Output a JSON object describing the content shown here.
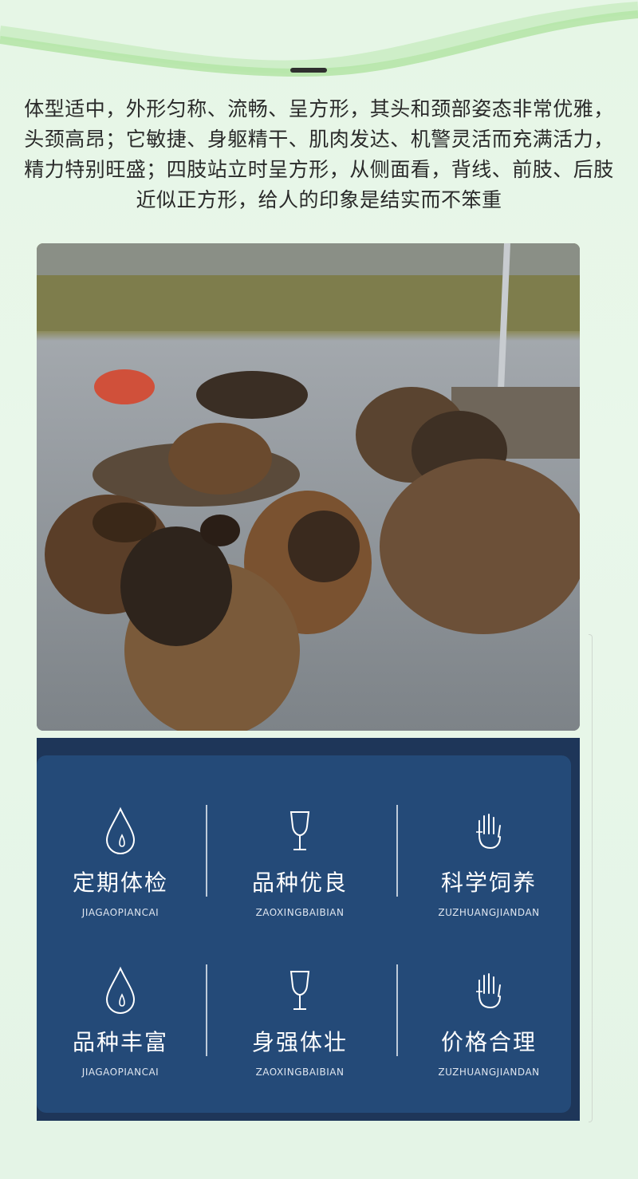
{
  "description": "体型适中，外形匀称、流畅、呈方形，其头和颈部姿态非常优雅，头颈高昂；它敏捷、身躯精干、肌肉发达、机警灵活而充满活力，精力特别旺盛；四肢站立时呈方形，从侧面看，背线、前肢、后肢近似正方形，给人的印象是结实而不笨重",
  "colors": {
    "panel_dark": "#1e3659",
    "panel_blue": "#244a78",
    "accent_green": "#b6e6a8"
  },
  "features": [
    {
      "title": "定期体检",
      "sub": "JIAGAOPIANCAI",
      "icon": "water-drop-icon"
    },
    {
      "title": "品种优良",
      "sub": "ZAOXINGBAIBIAN",
      "icon": "wine-glass-icon"
    },
    {
      "title": "科学饲养",
      "sub": "ZUZHUANGJIANDAN",
      "icon": "hand-icon"
    },
    {
      "title": "品种丰富",
      "sub": "JIAGAOPIANCAI",
      "icon": "water-drop-icon"
    },
    {
      "title": "身强体壮",
      "sub": "ZAOXINGBAIBIAN",
      "icon": "wine-glass-icon"
    },
    {
      "title": "价格合理",
      "sub": "ZUZHUANGJIANDAN",
      "icon": "hand-icon"
    }
  ]
}
